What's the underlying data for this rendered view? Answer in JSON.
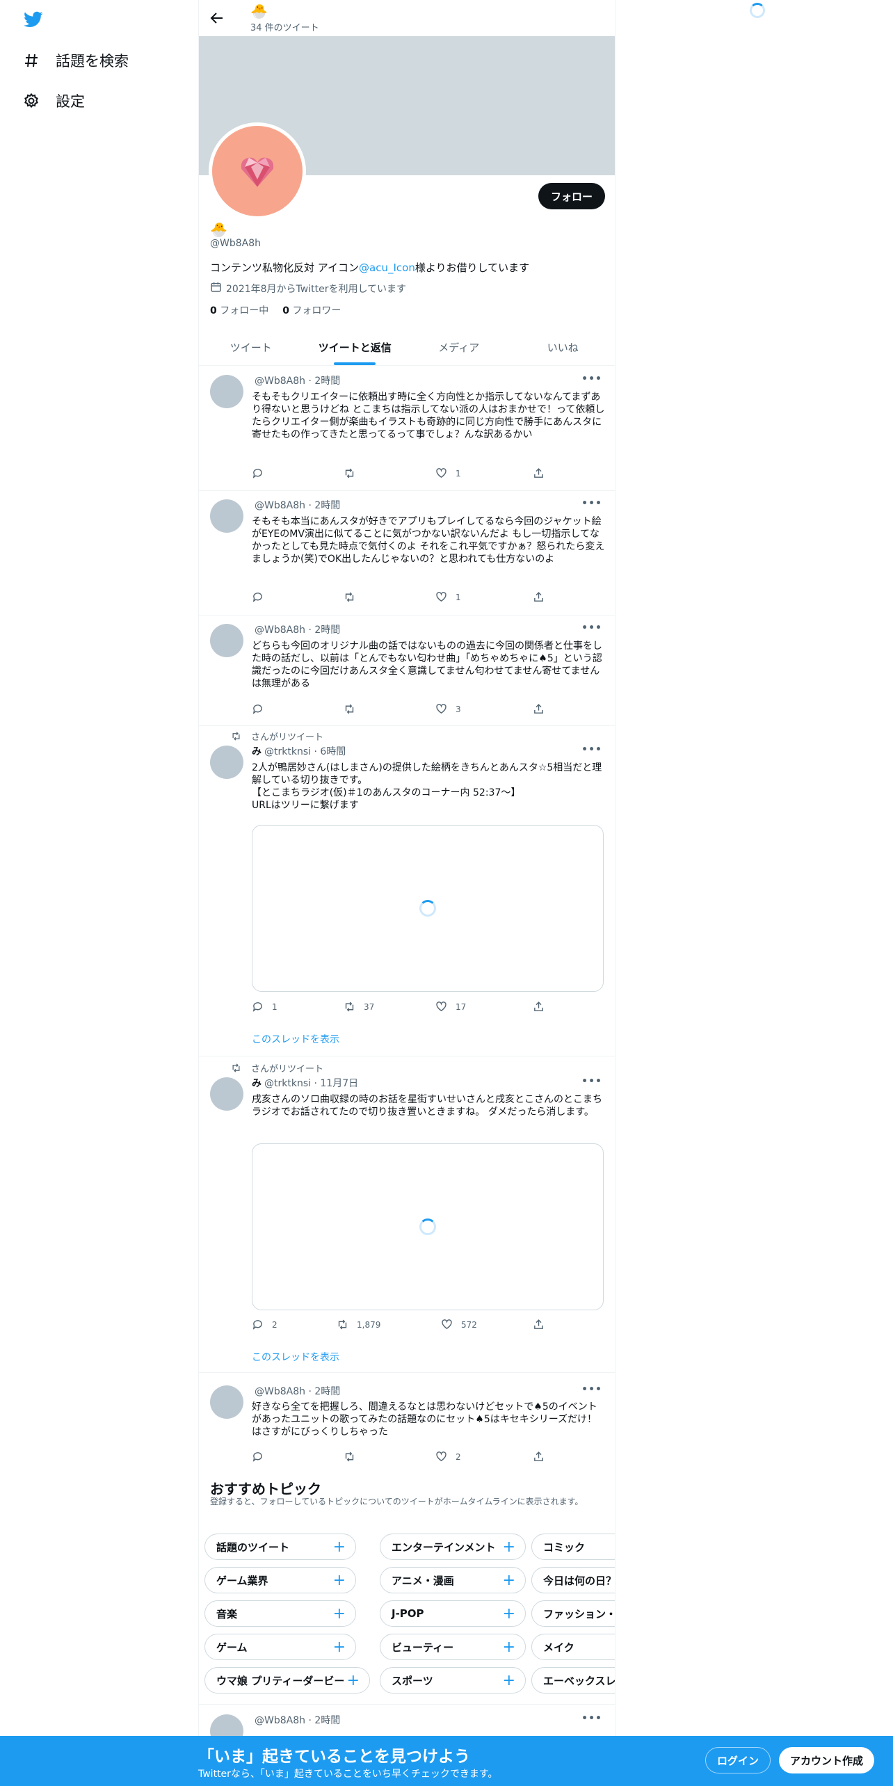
{
  "nav": {
    "items": [
      {
        "icon": "hashtag-icon",
        "label": "話題を検索"
      },
      {
        "icon": "gear-icon",
        "label": "設定"
      }
    ]
  },
  "profile": {
    "name_emoji": "🐣",
    "tweet_count": "34 件のツイート",
    "display_name": "🐣",
    "handle": "@Wb8A8h",
    "follow_label": "フォロー",
    "bio_prefix": "コンテンツ私物化反対 アイコン",
    "bio_link": "@acu_Icon",
    "bio_suffix": "様よりお借りしています",
    "joined": "2021年8月からTwitterを利用しています",
    "following_count": "0",
    "following_label": "フォロー中",
    "followers_count": "0",
    "followers_label": "フォロワー"
  },
  "tabs": [
    "ツイート",
    "ツイートと返信",
    "メディア",
    "いいね"
  ],
  "tweets": [
    {
      "display_name": "",
      "handle": "@Wb8A8h",
      "time": "2時間",
      "text": "そもそもクリエイターに依頼出す時に全く方向性とか指示してないなんてまずあり得ないと思うけどね とこまちは指示してない派の人はおまかせで！って依頼したらクリエイター側が楽曲もイラストも奇跡的に同じ方向性で勝手にあんスタに寄せたもの作ってきたと思ってるって事でしょ？んな訳あるかい",
      "replies": "",
      "retweets": "",
      "likes": "1"
    },
    {
      "display_name": "",
      "handle": "@Wb8A8h",
      "time": "2時間",
      "text": "そもそも本当にあんスタが好きでアプリもプレイしてるなら今回のジャケット絵がEYEのMV演出に似てることに気がつかない訳ないんだよ もし一切指示してなかったとしても見た時点で気付くのよ それをこれ平気ですかぁ？怒られたら変えましょうか(笑)でOK出したんじゃないの？と思われても仕方ないのよ",
      "replies": "",
      "retweets": "",
      "likes": "1"
    },
    {
      "display_name": "",
      "handle": "@Wb8A8h",
      "time": "2時間",
      "text": "どちらも今回のオリジナル曲の話ではないものの過去に今回の関係者と仕事をした時の話だし、以前は「とんでもない匂わせ曲」「めちゃめちゃに♠5」という認識だったのに今回だけあんスタ全く意識してません匂わせてません寄せてませんは無理がある",
      "replies": "",
      "retweets": "",
      "likes": "3"
    },
    {
      "retweeted_by": "さんがリツイート",
      "display_name": "み",
      "handle": "@trktknsi",
      "time": "6時間",
      "text": "2人が鴨居妙さん(はしまさん)の提供した絵柄をきちんとあんスタ☆5相当だと理解している切り抜きです。\n【とこまちラジオ(仮)＃1のあんスタのコーナー内 52:37〜】\nURLはツリーに繋げます",
      "replies": "1",
      "retweets": "37",
      "likes": "17",
      "thread": "このスレッドを表示"
    },
    {
      "retweeted_by": "さんがリツイート",
      "display_name": "み",
      "handle": "@trktknsi",
      "time": "11月7日",
      "text": "戌亥さんのソロ曲収録の時のお話を星街すいせいさんと戌亥とこさんのとこまちラジオでお話されてたので切り抜き置いときますね。 ダメだったら消します。",
      "replies": "2",
      "retweets": "1,879",
      "likes": "572",
      "thread": "このスレッドを表示"
    },
    {
      "display_name": "",
      "handle": "@Wb8A8h",
      "time": "2時間",
      "text": "好きなら全てを把握しろ、間違えるなとは思わないけどセットで♠5のイベントがあったユニットの歌ってみたの話題なのにセット♠5はキセキシリーズだけ！はさすがにびっくりしちゃった",
      "replies": "",
      "retweets": "",
      "likes": "2"
    },
    {
      "display_name": "",
      "handle": "@Wb8A8h",
      "time": "2時間",
      "text": "",
      "replies": "",
      "retweets": "",
      "likes": ""
    }
  ],
  "topics": {
    "title": "おすすめトピック",
    "subtitle": "登録すると、フォローしているトピックについてのツイートがホームタイムラインに表示されます。",
    "columns": [
      [
        "話題のツイート",
        "ゲーム業界",
        "音楽",
        "ゲーム",
        "ウマ娘 プリティーダービー"
      ],
      [
        "エンターテインメント",
        "アニメ・漫画",
        "J-POP",
        "ビューティー",
        "スポーツ"
      ],
      [
        "コミック",
        "今日は何の日？",
        "ファッション・",
        "メイク",
        "エーベックスレ"
      ]
    ]
  },
  "bottom": {
    "title": "「いま」起きていることを見つけよう",
    "subtitle": "Twitterなら、「いま」起きていることをいち早くチェックできます。",
    "login": "ログイン",
    "signup": "アカウント作成"
  },
  "colors": {
    "accent": "#1d9bf0",
    "banner": "#cfd9de",
    "avatar_bg": "#f7a68d"
  }
}
